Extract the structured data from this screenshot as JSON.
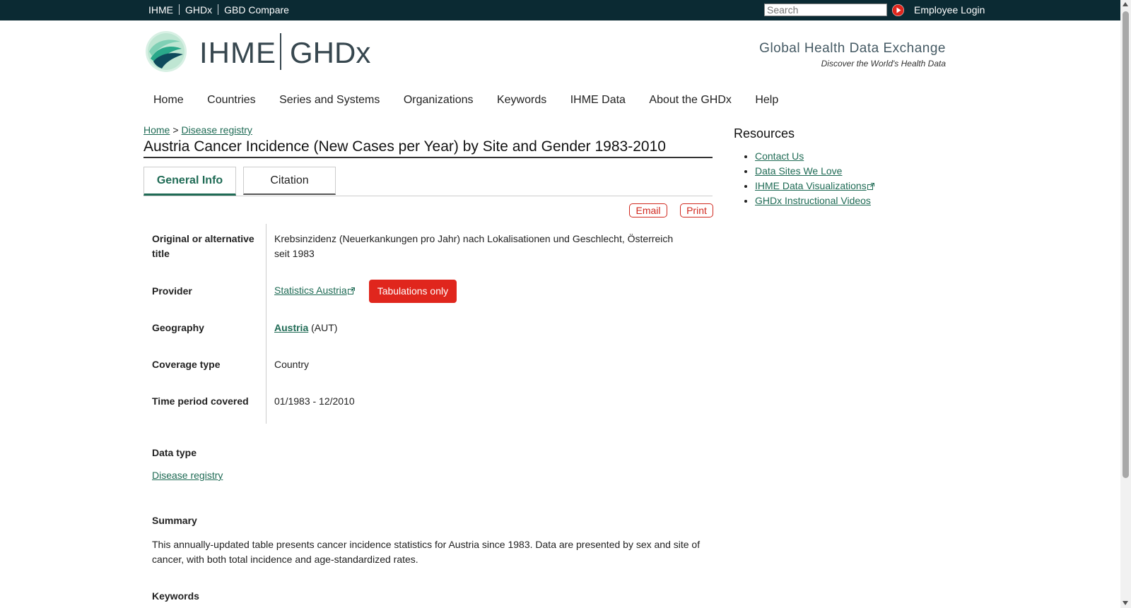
{
  "topbar": {
    "links": [
      "IHME",
      "GHDx",
      "GBD Compare"
    ],
    "search_placeholder": "Search",
    "employee_login": "Employee Login"
  },
  "header": {
    "logo_ihme": "IHME",
    "logo_ghdx": "GHDx",
    "tagline_title": "Global Health Data Exchange",
    "tagline_sub": "Discover the World's Health Data"
  },
  "nav": [
    "Home",
    "Countries",
    "Series and Systems",
    "Organizations",
    "Keywords",
    "IHME Data",
    "About the GHDx",
    "Help"
  ],
  "breadcrumb": {
    "home": "Home",
    "sep": ">",
    "current": "Disease registry"
  },
  "page_title": "Austria Cancer Incidence (New Cases per Year) by Site and Gender 1983-2010",
  "tabs": [
    "General Info",
    "Citation"
  ],
  "actions": {
    "email": "Email",
    "print": "Print"
  },
  "fields": {
    "alt_title_label": "Original or alternative title",
    "alt_title_value": "Krebsinzidenz (Neuerkankungen pro Jahr) nach Lokalisationen und Geschlecht, Österreich seit 1983",
    "provider_label": "Provider",
    "provider_value": "Statistics Austria",
    "provider_badge": "Tabulations only",
    "geography_label": "Geography",
    "geography_value": "Austria",
    "geography_code": "(AUT)",
    "coverage_label": "Coverage type",
    "coverage_value": "Country",
    "time_label": "Time period covered",
    "time_value": "01/1983 - 12/2010"
  },
  "data_type": {
    "title": "Data type",
    "value": "Disease registry"
  },
  "summary": {
    "title": "Summary",
    "text": "This annually-updated table presents cancer incidence statistics for Austria since 1983. Data are presented by sex and site of cancer, with both total incidence and age-standardized rates."
  },
  "keywords": {
    "title": "Keywords"
  },
  "resources": {
    "title": "Resources",
    "items": [
      "Contact Us",
      "Data Sites We Love",
      "IHME Data Visualizations",
      "GHDx Instructional Videos"
    ]
  },
  "colors": {
    "topbar": "#0b2a33",
    "link": "#1f6b55",
    "badge": "#e0261d"
  }
}
